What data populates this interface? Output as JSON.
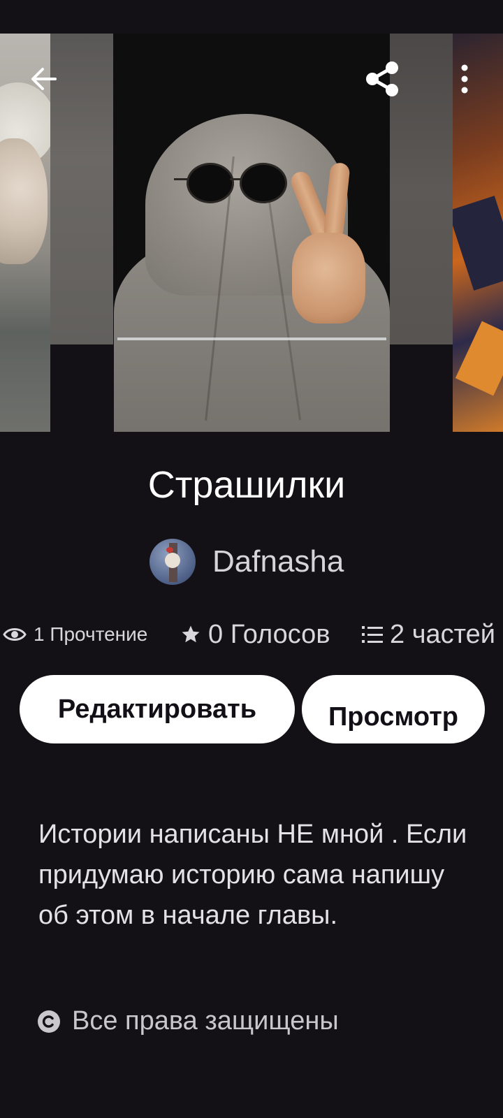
{
  "header": {
    "back_icon": "arrow-left-icon",
    "share_icon": "share-icon",
    "more_icon": "more-vertical-icon"
  },
  "story": {
    "title": "Страшилки",
    "author": "Dafnasha",
    "reads": "1 Прочтение",
    "votes": "0 Голосов",
    "parts": "2 частей",
    "description": "Истории написаны НЕ мной . Если придумаю историю сама напишу об этом в начале главы.",
    "copyright": "Все права защищены"
  },
  "actions": {
    "edit_label": "Редактировать",
    "preview_label": "Просмотр"
  },
  "colors": {
    "background": "#131116",
    "button_bg": "#ffffff",
    "button_text": "#121016",
    "secondary_text": "#d6d4da"
  }
}
